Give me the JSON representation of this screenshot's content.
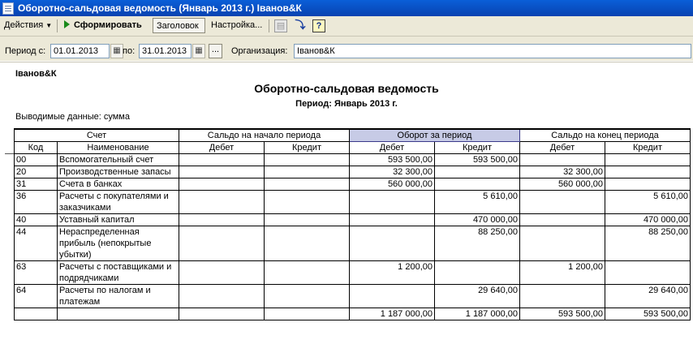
{
  "window": {
    "title": "Оборотно-сальдовая ведомость (Январь 2013 г.) Іванов&К"
  },
  "toolbar": {
    "actions": "Действия",
    "form": "Сформировать",
    "header": "Заголовок",
    "settings": "Настройка..."
  },
  "params": {
    "period_from_label": "Период с:",
    "period_from": "01.01.2013",
    "period_to_label": "по:",
    "period_to": "31.01.2013",
    "org_label": "Организация:",
    "org": "Іванов&К"
  },
  "report": {
    "org": "Іванов&К",
    "title": "Оборотно-сальдовая ведомость",
    "period": "Период: Январь 2013 г.",
    "data_shown": "Выводимые данные: сумма",
    "group_headers": [
      "Счет",
      "Сальдо на начало периода",
      "Оборот за период",
      "Сальдо на конец периода"
    ],
    "col_headers": [
      "Код",
      "Наименование",
      "Дебет",
      "Кредит",
      "Дебет",
      "Кредит",
      "Дебет",
      "Кредит"
    ],
    "rows": [
      {
        "code": "00",
        "name": "Вспомогательный счет",
        "sd": "",
        "sk": "",
        "od": "593 500,00",
        "ok": "593 500,00",
        "ed": "",
        "ek": ""
      },
      {
        "code": "20",
        "name": "Производственные запасы",
        "sd": "",
        "sk": "",
        "od": "32 300,00",
        "ok": "",
        "ed": "32 300,00",
        "ek": ""
      },
      {
        "code": "31",
        "name": "Счета в банках",
        "sd": "",
        "sk": "",
        "od": "560 000,00",
        "ok": "",
        "ed": "560 000,00",
        "ek": ""
      },
      {
        "code": "36",
        "name": "Расчеты с покупателями и заказчиками",
        "sd": "",
        "sk": "",
        "od": "",
        "ok": "5 610,00",
        "ed": "",
        "ek": "5 610,00"
      },
      {
        "code": "40",
        "name": "Уставный капитал",
        "sd": "",
        "sk": "",
        "od": "",
        "ok": "470 000,00",
        "ed": "",
        "ek": "470 000,00"
      },
      {
        "code": "44",
        "name": "Нераспределенная прибыль (непокрытые убытки)",
        "sd": "",
        "sk": "",
        "od": "",
        "ok": "88 250,00",
        "ed": "",
        "ek": "88 250,00"
      },
      {
        "code": "63",
        "name": "Расчеты с поставщиками и подрядчиками",
        "sd": "",
        "sk": "",
        "od": "1 200,00",
        "ok": "",
        "ed": "1 200,00",
        "ek": ""
      },
      {
        "code": "64",
        "name": "Расчеты по налогам и платежам",
        "sd": "",
        "sk": "",
        "od": "",
        "ok": "29 640,00",
        "ed": "",
        "ek": "29 640,00"
      }
    ],
    "totals": {
      "sd": "",
      "sk": "",
      "od": "1 187 000,00",
      "ok": "1 187 000,00",
      "ed": "593 500,00",
      "ek": "593 500,00"
    }
  }
}
